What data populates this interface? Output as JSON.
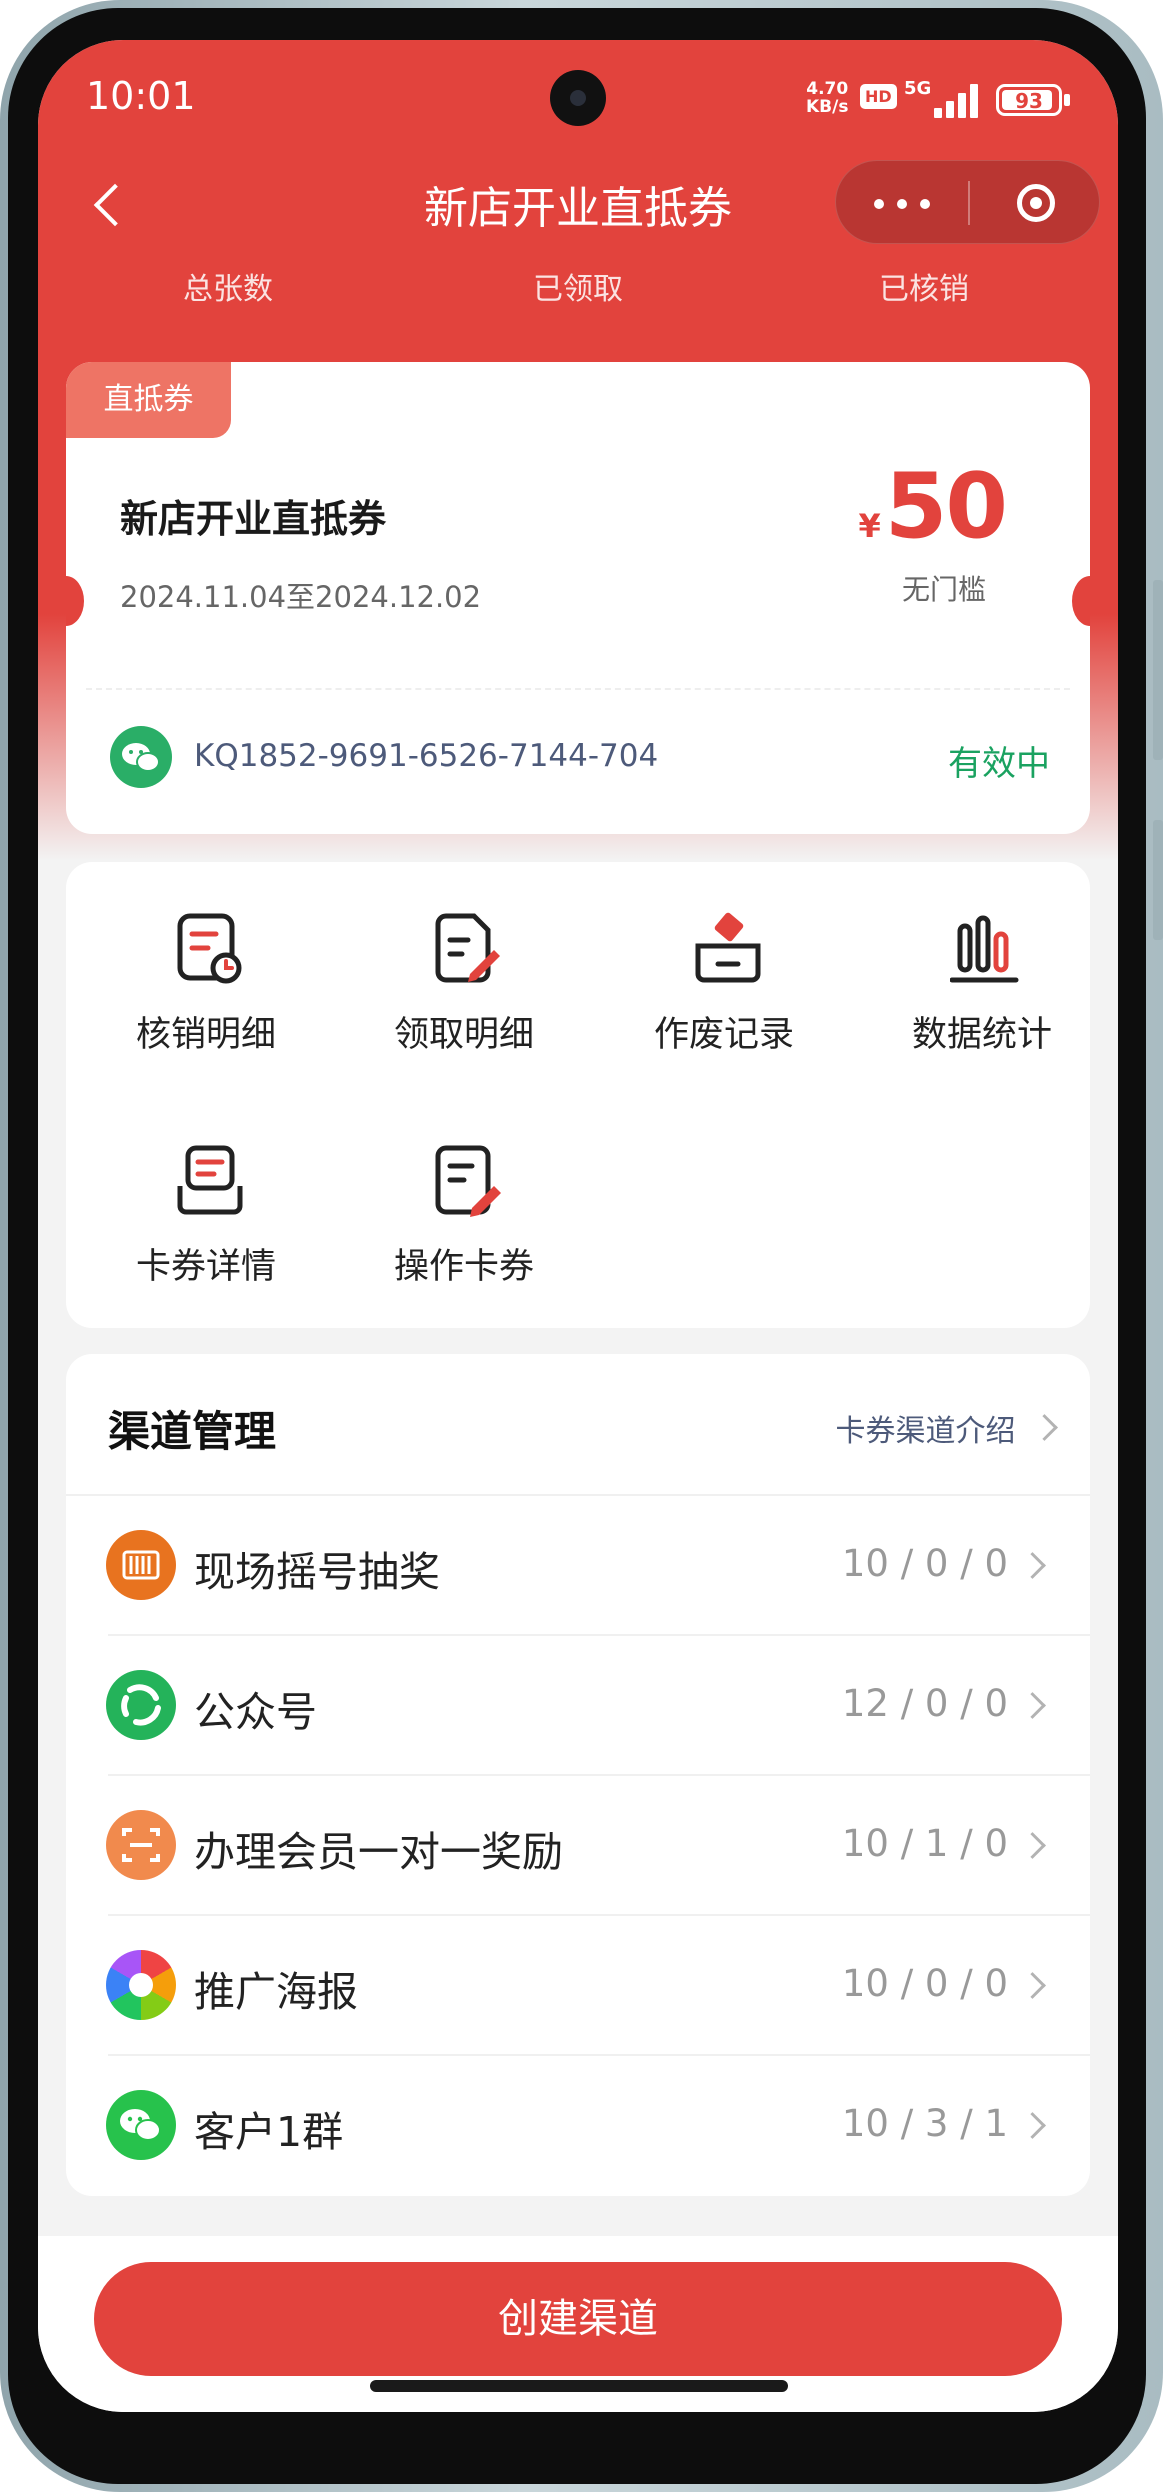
{
  "status_bar": {
    "time": "10:01",
    "net_speed_value": "4.70",
    "net_speed_unit": "KB/s",
    "hd_badge": "HD",
    "network": "5G",
    "battery": "93"
  },
  "header": {
    "title": "新店开业直抵券",
    "stats": [
      "总张数",
      "已领取",
      "已核销"
    ]
  },
  "coupon": {
    "tag": "直抵券",
    "name": "新店开业直抵券",
    "date_range": "2024.11.04至2024.12.02",
    "currency": "¥",
    "amount": "50",
    "threshold": "无门槛",
    "code": "KQ1852-9691-6526-7144-704",
    "status": "有效中"
  },
  "actions": [
    {
      "label": "核销明细",
      "icon": "redeem-detail-icon"
    },
    {
      "label": "领取明细",
      "icon": "claim-detail-icon"
    },
    {
      "label": "作废记录",
      "icon": "void-record-icon"
    },
    {
      "label": "数据统计",
      "icon": "statistics-icon"
    },
    {
      "label": "卡券详情",
      "icon": "card-detail-icon"
    },
    {
      "label": "操作卡券",
      "icon": "operate-card-icon"
    }
  ],
  "channels": {
    "title": "渠道管理",
    "intro_link": "卡券渠道介绍",
    "items": [
      {
        "name": "现场摇号抽奖",
        "counts": "10 / 0 / 0",
        "icon": "lottery-icon",
        "color": "#e8731f"
      },
      {
        "name": "公众号",
        "counts": "12 / 0 / 0",
        "icon": "official-account-icon",
        "color": "#24b35a"
      },
      {
        "name": "办理会员一对一奖励",
        "counts": "10 / 1 / 0",
        "icon": "member-reward-icon",
        "color": "#f18a4d"
      },
      {
        "name": "推广海报",
        "counts": "10 / 0 / 0",
        "icon": "promo-poster-icon",
        "color": "#3b82f6"
      },
      {
        "name": "客户1群",
        "counts": "10 / 3 / 1",
        "icon": "wechat-group-icon",
        "color": "#27c24c"
      }
    ]
  },
  "bottom": {
    "create_button": "创建渠道"
  },
  "colors": {
    "brand_red": "#e2433d",
    "status_green": "#1aa260"
  }
}
